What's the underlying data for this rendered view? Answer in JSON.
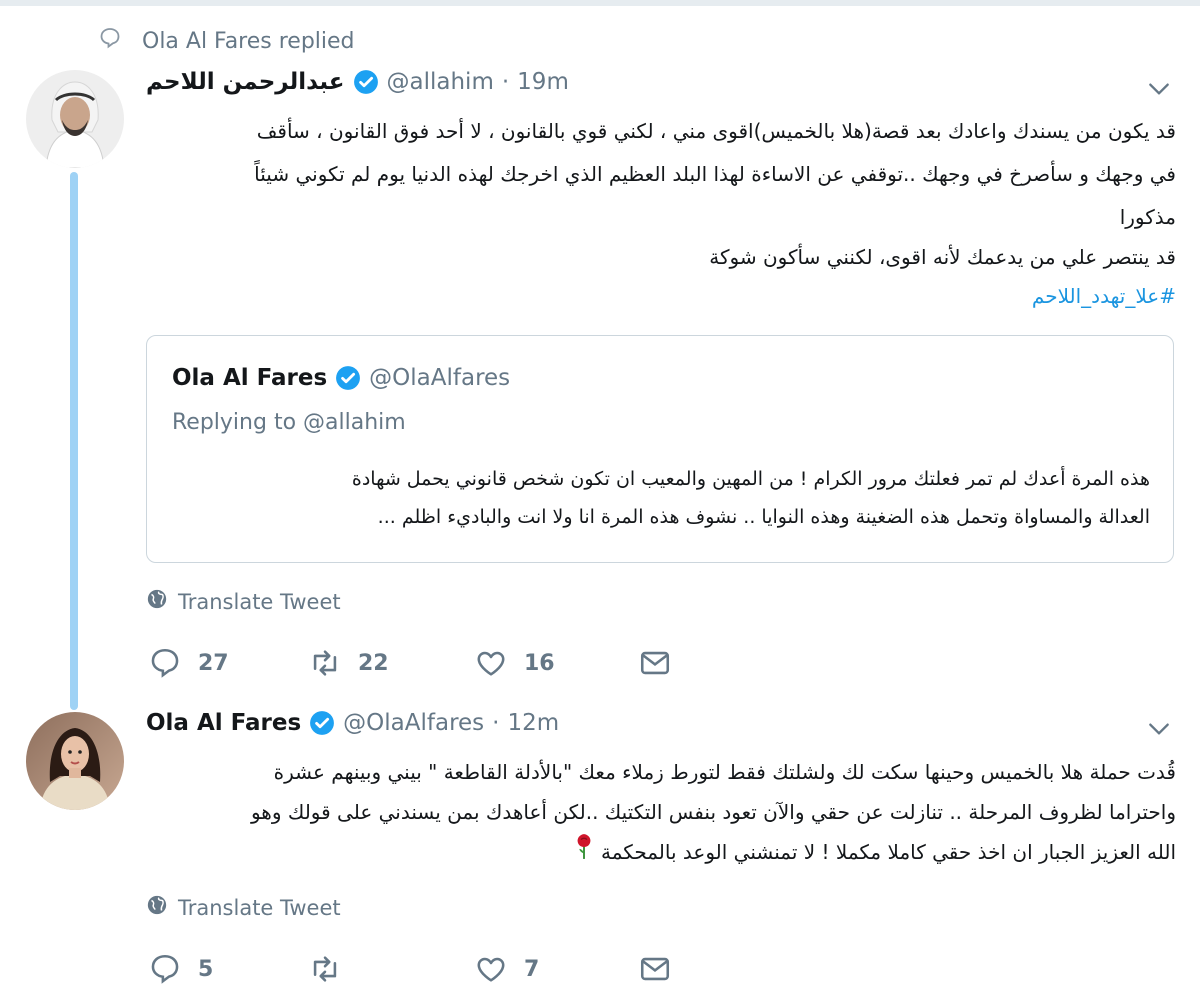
{
  "context": {
    "text": "Ola Al Fares replied"
  },
  "tweet1": {
    "name": "عبدالرحمن اللاحم",
    "handle": "@allahim",
    "dot": "·",
    "time": "19m",
    "lines": [
      "قد يكون من يسندك واعادك بعد قصة(هلا بالخميس)اقوى مني ، لكني قوي بالقانون ، لا أحد فوق القانون ، سأقف",
      "في وجهك و سأصرخ في وجهك ..توقفي عن الاساءة لهذا البلد العظيم الذي اخرجك لهذه الدنيا يوم لم تكوني شيئاً",
      "مذكورا",
      "قد ينتصر علي من يدعمك لأنه اقوى، لكنني سأكون شوكة"
    ],
    "hashtag": "#علا_تهدد_اللاحم",
    "quote": {
      "name": "Ola Al Fares",
      "handle": "@OlaAlfares",
      "replying": "Replying to @allahim",
      "lines": [
        "هذه المرة أعدك لم تمر فعلتك مرور الكرام ! من المهين والمعيب ان تكون شخص قانوني يحمل شهادة",
        "العدالة والمساواة وتحمل هذه الضغينة وهذه النوايا .. نشوف هذه المرة انا ولا انت والباديء اظلم ..."
      ]
    },
    "translate": "Translate Tweet",
    "counts": {
      "replies": "27",
      "retweets": "22",
      "likes": "16"
    }
  },
  "tweet2": {
    "name": "Ola Al Fares",
    "handle": "@OlaAlfares",
    "dot": "·",
    "time": "12m",
    "lines": [
      "قُدت  حملة هلا بالخميس وحينها سكت لك ولشلتك  فقط لتورط زملاء  معك \"بالأدلة القاطعة \" بيني وبينهم عشرة",
      "واحتراما لظروف المرحلة .. تنازلت عن حقي والآن تعود بنفس التكتيك ..لكن أعاهدك بمن يسندني على قولك وهو",
      "الله العزيز الجبار  ان اخذ حقي كاملا مكملا ! لا تمنشني الوعد بالمحكمة"
    ],
    "emoji": "rose-icon",
    "translate": "Translate Tweet",
    "counts": {
      "replies": "5",
      "retweets": "",
      "likes": "7"
    }
  },
  "colors": {
    "accent": "#1da1f2",
    "link": "#1b95e0",
    "muted": "#657786",
    "thread": "#9fd2f5",
    "rose": "#d0152b"
  }
}
